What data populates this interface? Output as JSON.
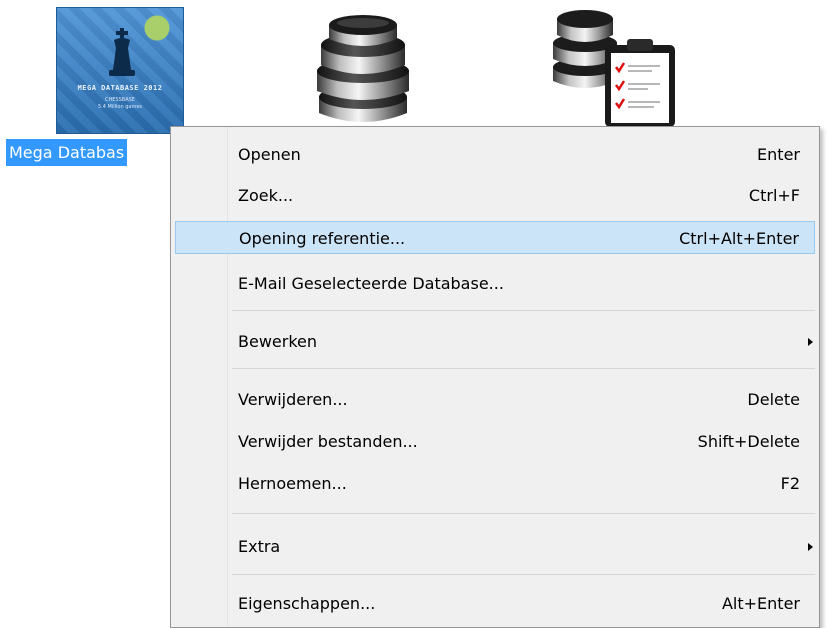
{
  "desktop": {
    "mega_database": {
      "label": "Mega Databas",
      "cover_title": "MEGA DATABASE 2012",
      "cover_line_1": "CHESSBASE",
      "cover_line_2": "5.4 Million games"
    },
    "database_icon": {
      "icon": "database-stack-icon"
    },
    "database_list_icon": {
      "icon": "database-checklist-icon"
    }
  },
  "context_menu": {
    "items": [
      {
        "label": "Openen",
        "shortcut": "Enter"
      },
      {
        "label": "Zoek...",
        "shortcut": "Ctrl+F"
      },
      {
        "label": "Opening referentie...",
        "shortcut": "Ctrl+Alt+Enter",
        "highlighted": true
      },
      {
        "label": "E-Mail Geselecteerde Database...",
        "shortcut": ""
      },
      {
        "label": "Bewerken",
        "shortcut": "",
        "submenu": true
      },
      {
        "label": "Verwijderen...",
        "shortcut": "Delete"
      },
      {
        "label": "Verwijder bestanden...",
        "shortcut": "Shift+Delete"
      },
      {
        "label": "Hernoemen...",
        "shortcut": "F2"
      },
      {
        "label": "Extra",
        "shortcut": "",
        "submenu": true
      },
      {
        "label": "Eigenschappen...",
        "shortcut": "Alt+Enter"
      }
    ]
  },
  "colors": {
    "selection": "#3399ff",
    "menu_background": "#f0f0f0",
    "menu_highlight": "#cce4f7",
    "menu_highlight_border": "#99c9ef"
  }
}
